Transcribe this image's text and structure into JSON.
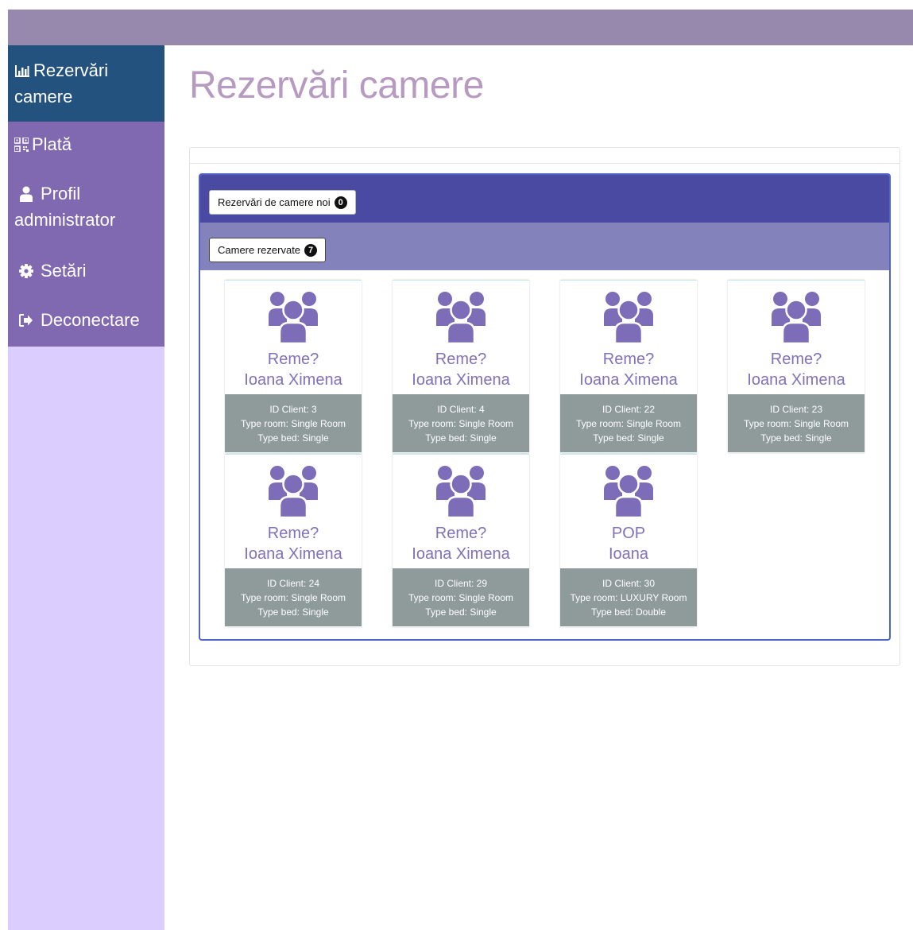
{
  "sidebar": {
    "items": [
      {
        "label_line1": "Rezervări",
        "label_line2": "camere",
        "icon": "bar-chart-icon",
        "active": true
      },
      {
        "label": "Plată",
        "icon": "qrcode-icon"
      },
      {
        "label_line1": "Profil",
        "label_line2": "administrator",
        "icon": "user-icon"
      },
      {
        "label": "Setări",
        "icon": "gear-icon"
      },
      {
        "label": "Deconectare",
        "icon": "logout-icon"
      }
    ]
  },
  "page": {
    "title": "Rezervări camere"
  },
  "panels": {
    "new_label": "Rezervări de camere noi",
    "new_count": "0",
    "reserved_label": "Camere rezervate",
    "reserved_count": "7"
  },
  "cards": [
    {
      "line1": "Reme?",
      "line2": "Ioana Ximena",
      "id_client": "ID Client: 3",
      "type_room": "Type room: Single Room",
      "type_bed": "Type bed: Single"
    },
    {
      "line1": "Reme?",
      "line2": "Ioana Ximena",
      "id_client": "ID Client: 4",
      "type_room": "Type room: Single Room",
      "type_bed": "Type bed: Single"
    },
    {
      "line1": "Reme?",
      "line2": "Ioana Ximena",
      "id_client": "ID Client: 22",
      "type_room": "Type room: Single Room",
      "type_bed": "Type bed: Single"
    },
    {
      "line1": "Reme?",
      "line2": "Ioana Ximena",
      "id_client": "ID Client: 23",
      "type_room": "Type room: Single Room",
      "type_bed": "Type bed: Single"
    },
    {
      "line1": "Reme?",
      "line2": "Ioana Ximena",
      "id_client": "ID Client: 24",
      "type_room": "Type room: Single Room",
      "type_bed": "Type bed: Single"
    },
    {
      "line1": "Reme?",
      "line2": "Ioana Ximena",
      "id_client": "ID Client: 29",
      "type_room": "Type room: Single Room",
      "type_bed": "Type bed: Single"
    },
    {
      "line1": "POP",
      "line2": "Ioana",
      "id_client": "ID Client: 30",
      "type_room": "Type room: LUXURY Room",
      "type_bed": "Type bed: Double"
    }
  ],
  "colors": {
    "topbar": "#9789ae",
    "sidebar_bg": "#dccdff",
    "sidebar_nav": "#8069b0",
    "sidebar_active": "#24527f",
    "title": "#b69ac0",
    "band_new": "#4a4aa3",
    "band_reserved": "#8382bb",
    "card_name": "#8171b9",
    "card_info_bg": "#8f9a9a"
  }
}
